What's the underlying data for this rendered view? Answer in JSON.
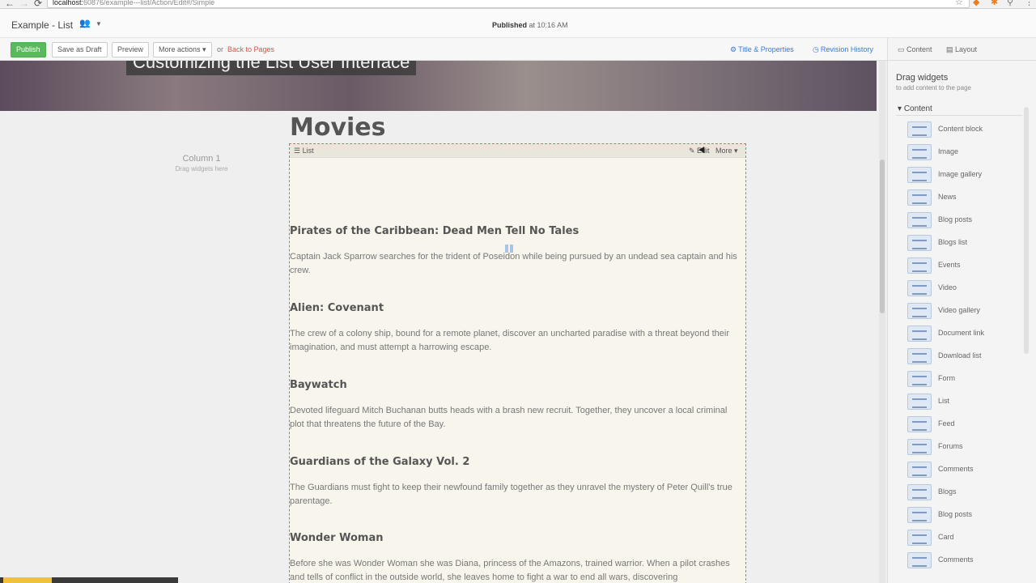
{
  "browser": {
    "back": "←",
    "forward": "→",
    "reload": "⟳",
    "url_host": "localhost:",
    "url_path": "60876/example---list/Action/Edit#/Simple"
  },
  "topbar": {
    "site_title": "Example - List",
    "published_label": "Published",
    "published_time": "at 10:16 AM"
  },
  "toolbar": {
    "publish": "Publish",
    "save_draft": "Save as Draft",
    "preview": "Preview",
    "more_actions": "More actions ▾",
    "or": "or",
    "back_to_pages": "Back to Pages",
    "title_properties": "Title & Properties",
    "revision_history": "Revision History"
  },
  "panel": {
    "tab_content": "Content",
    "tab_layout": "Layout",
    "drag_title": "Drag widgets",
    "drag_sub": "to add content to the page",
    "category": "Content",
    "widgets": [
      "Content block",
      "Image",
      "Image gallery",
      "News",
      "Blog posts",
      "Blogs list",
      "Events",
      "Video",
      "Video gallery",
      "Document link",
      "Download list",
      "Form",
      "List",
      "Feed",
      "Forums",
      "Comments",
      "Blogs",
      "Blog posts",
      "Card",
      "Comments"
    ]
  },
  "canvas": {
    "hero_title": "Customizing the List User Interface",
    "column_title": "Column 1",
    "column_sub": "Drag widgets here",
    "widget_label": "List",
    "widget_edit": "Edit",
    "widget_more": "More ▾",
    "list_title": "Movies",
    "movies": [
      {
        "title": "Pirates of the Caribbean: Dead Men Tell No Tales",
        "desc": "Captain Jack Sparrow searches for the trident of Poseidon while being pursued by an undead sea captain and his crew."
      },
      {
        "title": "Alien: Covenant",
        "desc": "The crew of a colony ship, bound for a remote planet, discover an uncharted paradise with a threat beyond their imagination, and must attempt a harrowing escape."
      },
      {
        "title": "Baywatch",
        "desc": "Devoted lifeguard Mitch Buchanan butts heads with a brash new recruit. Together, they uncover a local criminal plot that threatens the future of the Bay."
      },
      {
        "title": "Guardians of the Galaxy Vol. 2",
        "desc": "The Guardians must fight to keep their newfound family together as they unravel the mystery of Peter Quill's true parentage."
      },
      {
        "title": "Wonder Woman",
        "desc": "Before she was Wonder Woman she was Diana, princess of the Amazons, trained warrior. When a pilot crashes and tells of conflict in the outside world, she leaves home to fight a war to end all wars, discovering"
      }
    ]
  }
}
